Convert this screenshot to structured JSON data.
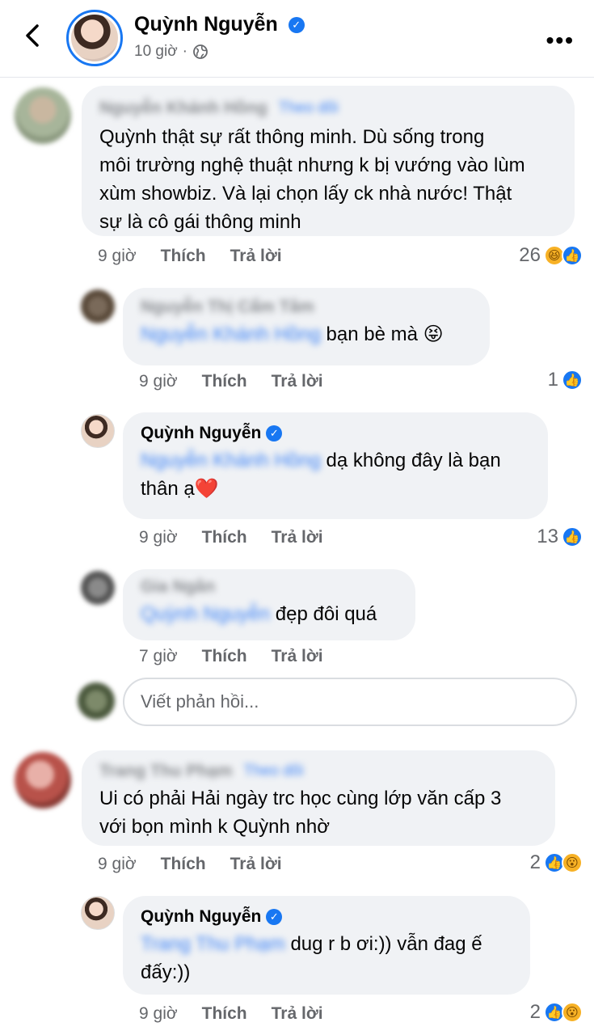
{
  "header": {
    "author_name": "Quỳnh Nguyễn",
    "time": "10 giờ",
    "separator": "·",
    "verified_glyph": "✓",
    "more_glyph": "•••"
  },
  "comments": [
    {
      "author": "Nguyễn Khánh Hồng",
      "tag": "Theo dõi",
      "text_lines": [
        "Quỳnh thật sự rất thông minh. Dù sống trong",
        "môi trường nghệ thuật nhưng k bị vướng vào lùm",
        "xùm showbiz. Và lại chọn lấy ck nhà nước! Thật",
        "sự là cô gái thông minh"
      ],
      "time": "9 giờ",
      "like": "Thích",
      "reply": "Trả lời",
      "reaction_count": "26",
      "reactions": [
        "haha",
        "like"
      ]
    },
    {
      "author": "Nguyễn Thị Cẩm Tâm",
      "mention": "Nguyễn Khánh Hồng",
      "text": "bạn bè mà 😝",
      "time": "9 giờ",
      "like": "Thích",
      "reply": "Trả lời",
      "reaction_count": "1",
      "reactions": [
        "like"
      ]
    },
    {
      "author": "Quỳnh Nguyễn",
      "mention": "Nguyễn Khánh Hồng",
      "text_line1": "dạ không đây là bạn",
      "text_line2": "thân ạ❤️",
      "time": "9 giờ",
      "like": "Thích",
      "reply": "Trả lời",
      "reaction_count": "13",
      "reactions": [
        "like"
      ]
    },
    {
      "author": "Gia Ngân",
      "mention": "Quỳnh Nguyễn",
      "text": "đẹp đôi quá",
      "time": "7 giờ",
      "like": "Thích",
      "reply": "Trả lời"
    },
    {
      "author": "Trang Thu Phạm",
      "tag": "Theo dõi",
      "text_lines": [
        "Ui có phải Hải ngày trc học cùng lớp văn cấp 3",
        "với bọn mình k Quỳnh nhờ"
      ],
      "time": "9 giờ",
      "like": "Thích",
      "reply": "Trả lời",
      "reaction_count": "2",
      "reactions": [
        "like",
        "wow"
      ]
    },
    {
      "author": "Quỳnh Nguyễn",
      "mention": "Trang Thu Phạm",
      "text_line1": "dug r b ơi:)) vẫn đag ế",
      "text_line2": "đấy:))",
      "time": "9 giờ",
      "like": "Thích",
      "reply": "Trả lời",
      "reaction_count": "2",
      "reactions": [
        "like",
        "wow"
      ]
    }
  ],
  "reply_input": {
    "placeholder": "Viết phản hồi..."
  },
  "icons": {
    "like": "👍",
    "haha": "😆",
    "wow": "😮"
  }
}
